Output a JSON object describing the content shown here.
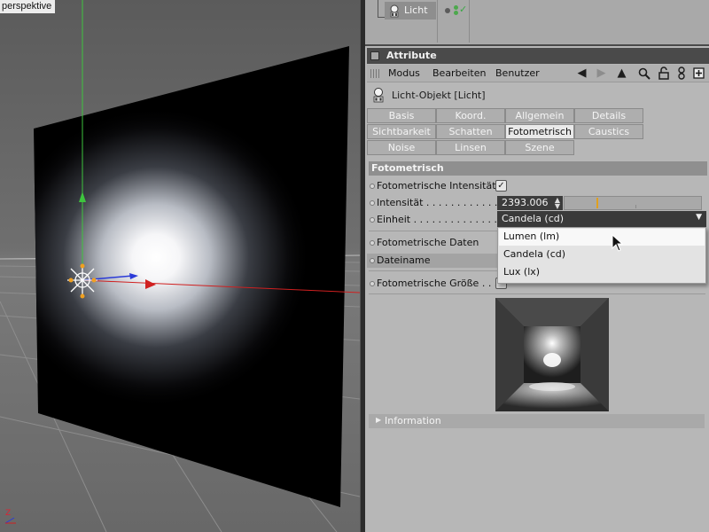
{
  "viewport": {
    "label": "perspektive",
    "axis_label": "Z"
  },
  "object_manager": {
    "object_name": "Licht"
  },
  "attribute_manager": {
    "header": "Attribute",
    "menu": [
      "Modus",
      "Bearbeiten",
      "Benutzer"
    ],
    "toolbar_icons": [
      "back-arrow-icon",
      "forward-arrow-icon",
      "up-arrow-icon",
      "search-icon",
      "lock-icon",
      "link-icon",
      "new-window-icon"
    ],
    "object_title": "Licht-Objekt [Licht]",
    "tabs": [
      {
        "label": "Basis",
        "active": false
      },
      {
        "label": "Koord.",
        "active": false
      },
      {
        "label": "Allgemein",
        "active": false
      },
      {
        "label": "Details",
        "active": false
      },
      {
        "label": "Sichtbarkeit",
        "active": false
      },
      {
        "label": "Schatten",
        "active": false
      },
      {
        "label": "Fotometrisch",
        "active": true
      },
      {
        "label": "Caustics",
        "active": false
      },
      {
        "label": "Noise",
        "active": false
      },
      {
        "label": "Linsen",
        "active": false
      },
      {
        "label": "Szene",
        "active": false
      }
    ],
    "section": "Fotometrisch",
    "params": {
      "fotometrische_intensitaet": {
        "label": "Fotometrische Intensität",
        "checked": true
      },
      "intensitaet": {
        "label": "Intensität . . . . . . . . . . . .",
        "value": "2393.006",
        "slider_fraction": 0.24
      },
      "einheit": {
        "label": "Einheit . . . . . . . . . . . . . .",
        "value": "Candela (cd)"
      },
      "fotometrische_daten": {
        "label": "Fotometrische Daten"
      },
      "dateiname": {
        "label": "Dateiname"
      },
      "fotometrische_groesse": {
        "label": "Fotometrische Größe . . ."
      }
    },
    "unit_dropdown": {
      "options": [
        "Lumen (lm)",
        "Candela (cd)",
        "Lux (lx)"
      ],
      "hovered": "Lumen (lm)"
    },
    "information": "Information"
  },
  "colors": {
    "active_tab": "#e9e9e9",
    "panel_bg": "#b7b7b7",
    "header_bg": "#4a4a4a",
    "slider_thumb": "#e0a020"
  }
}
